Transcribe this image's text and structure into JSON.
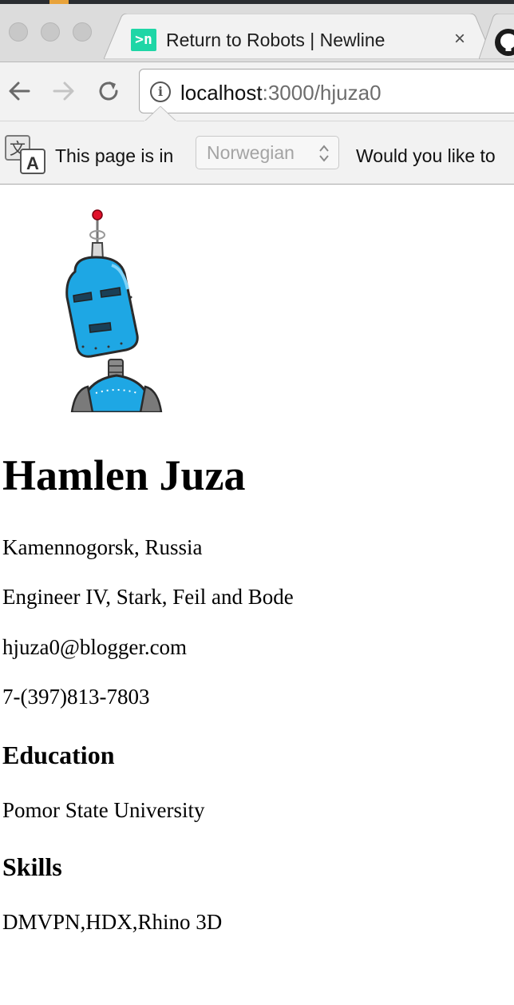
{
  "browser": {
    "tab": {
      "favicon": ">n",
      "title": "Return to Robots | Newline",
      "close": "×"
    },
    "address": {
      "host": "localhost",
      "path": ":3000/hjuza0"
    },
    "translate_bar": {
      "prefix": "This page is in",
      "language": "Norwegian",
      "question": "Would you like to"
    },
    "icons": [
      "back-icon",
      "forward-icon",
      "reload-icon",
      "info-icon",
      "translate-icon",
      "github-icon",
      "close-icon"
    ]
  },
  "profile": {
    "name": "Hamlen Juza",
    "location": "Kamennogorsk, Russia",
    "job": "Engineer IV, Stark, Feil and Bode",
    "email": "hjuza0@blogger.com",
    "phone": "7-(397)813-7803",
    "education_heading": "Education",
    "education": "Pomor State University",
    "skills_heading": "Skills",
    "skills": "DMVPN,HDX,Rhino 3D"
  },
  "colors": {
    "favicon": "#1ed6a6",
    "robot_body": "#1ea7e4",
    "robot_antenna_tip": "#e0102a"
  }
}
